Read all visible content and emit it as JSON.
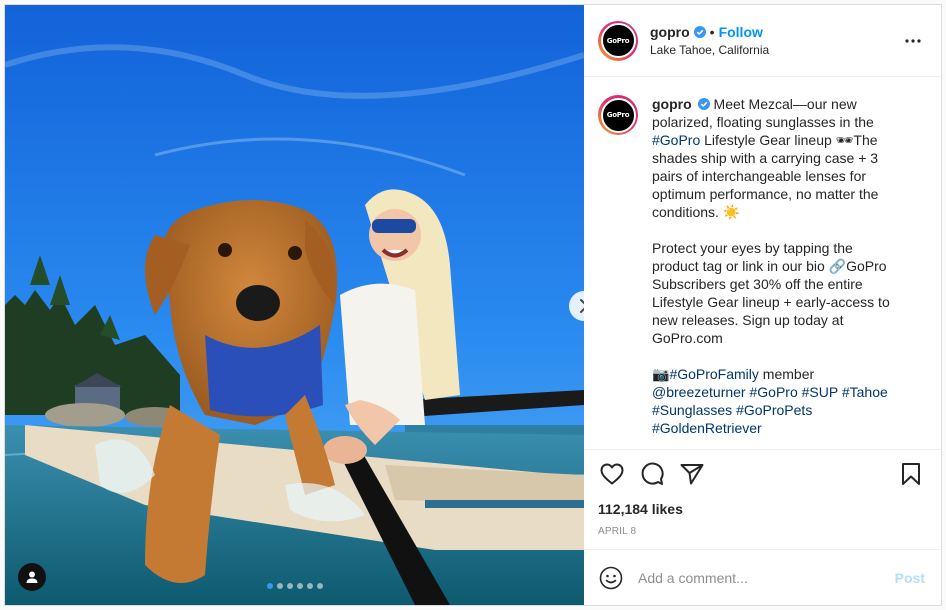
{
  "header": {
    "username": "gopro",
    "separator": "•",
    "follow_label": "Follow",
    "location": "Lake Tahoe, California",
    "avatar_text": "GoPro"
  },
  "media": {
    "carousel_dots": 6,
    "active_dot": 0
  },
  "caption": {
    "username": "gopro",
    "segments": [
      {
        "text": " Meet Mezcal—our new polarized, floating sunglasses in the "
      },
      {
        "text": "#GoPro",
        "tag": true
      },
      {
        "text": " Lifestyle Gear lineup 🕶The shades ship with a carrying case + 3 pairs of interchangeable lenses for optimum performance, no matter the conditions. ☀️\n\nProtect your eyes by tapping the product tag or link in our bio 🔗GoPro Subscribers get 30% off the entire Lifestyle Gear lineup + early-access to new releases. Sign up today at GoPro.com\n\n📷"
      },
      {
        "text": "#GoProFamily",
        "tag": true
      },
      {
        "text": " member\n"
      },
      {
        "text": "@breezeturner",
        "tag": true
      },
      {
        "text": " "
      },
      {
        "text": "#GoPro",
        "tag": true
      },
      {
        "text": " "
      },
      {
        "text": "#SUP",
        "tag": true
      },
      {
        "text": " "
      },
      {
        "text": "#Tahoe",
        "tag": true
      },
      {
        "text": "\n"
      },
      {
        "text": "#Sunglasses",
        "tag": true
      },
      {
        "text": " "
      },
      {
        "text": "#GoProPets",
        "tag": true
      },
      {
        "text": "\n"
      },
      {
        "text": "#GoldenRetriever",
        "tag": true
      }
    ]
  },
  "engagement": {
    "likes": "112,184 likes",
    "date": "APRIL 8"
  },
  "comment": {
    "placeholder": "Add a comment...",
    "post_label": "Post"
  },
  "colors": {
    "accent": "#0095f6",
    "hashtag": "#00376b",
    "post_disabled": "#b2dffc"
  },
  "icons": {
    "verified": "verified-badge-icon",
    "more": "more-options-icon",
    "like": "heart-icon",
    "comment": "comment-bubble-icon",
    "share": "paper-plane-icon",
    "save": "bookmark-icon",
    "emoji": "emoji-smile-icon",
    "user_tags": "user-tag-icon",
    "next": "chevron-right-icon"
  }
}
